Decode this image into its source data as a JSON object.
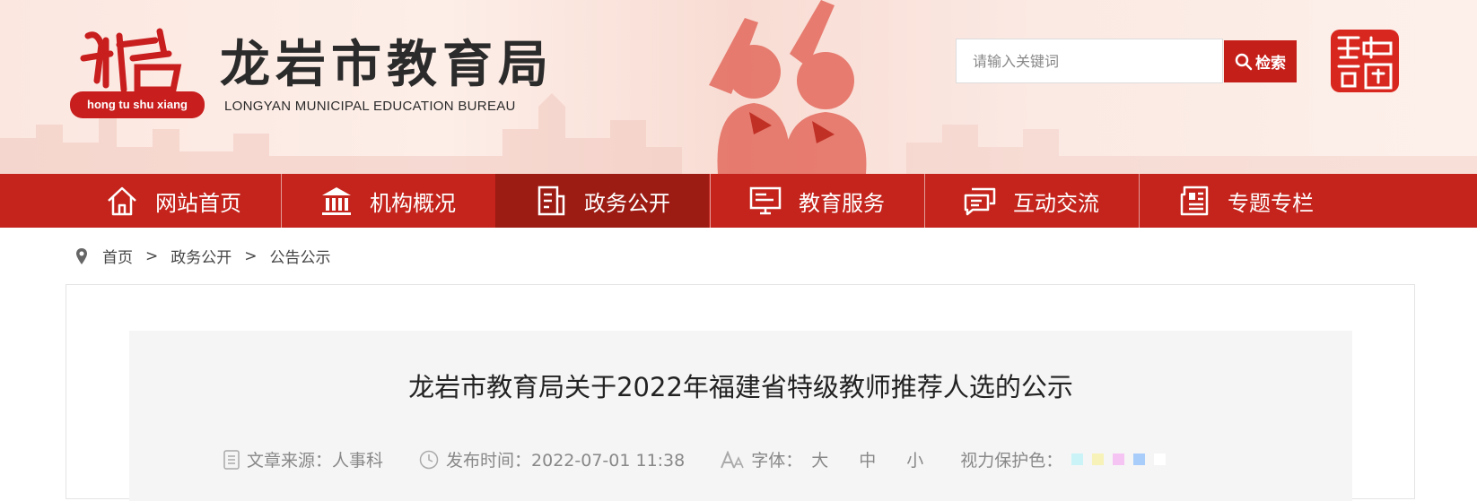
{
  "header": {
    "emblem_text": "hong tu shu xiang",
    "site_title": "龙岩市教育局",
    "site_subtitle": "LONGYAN MUNICIPAL EDUCATION BUREAU",
    "search": {
      "placeholder": "请输入关键词",
      "button_label": "检索"
    },
    "seal_text": "中國龍岩"
  },
  "nav": {
    "items": [
      {
        "label": "网站首页",
        "icon": "home-icon"
      },
      {
        "label": "机构概况",
        "icon": "institution-icon"
      },
      {
        "label": "政务公开",
        "icon": "document-icon",
        "active": true
      },
      {
        "label": "教育服务",
        "icon": "monitor-icon"
      },
      {
        "label": "互动交流",
        "icon": "chat-icon"
      },
      {
        "label": "专题专栏",
        "icon": "newspaper-icon"
      }
    ]
  },
  "breadcrumb": {
    "items": [
      "首页",
      "政务公开",
      "公告公示"
    ],
    "separator": ">"
  },
  "article": {
    "title": "龙岩市教育局关于2022年福建省特级教师推荐人选的公示",
    "source_label": "文章来源：人事科",
    "time_label": "发布时间：2022-07-01 11:38",
    "font_label": "字体：",
    "font_sizes": [
      "大",
      "中",
      "小"
    ],
    "eye_care_label": "视力保护色：",
    "eye_care_colors": [
      "#c9f3f7",
      "#f7f2b8",
      "#f6c4f3",
      "#a9cdfa",
      "#ffffff"
    ]
  },
  "colors": {
    "brand_red": "#c4241c",
    "active_nav": "#9c1c14",
    "search_button": "#c51f1a"
  }
}
